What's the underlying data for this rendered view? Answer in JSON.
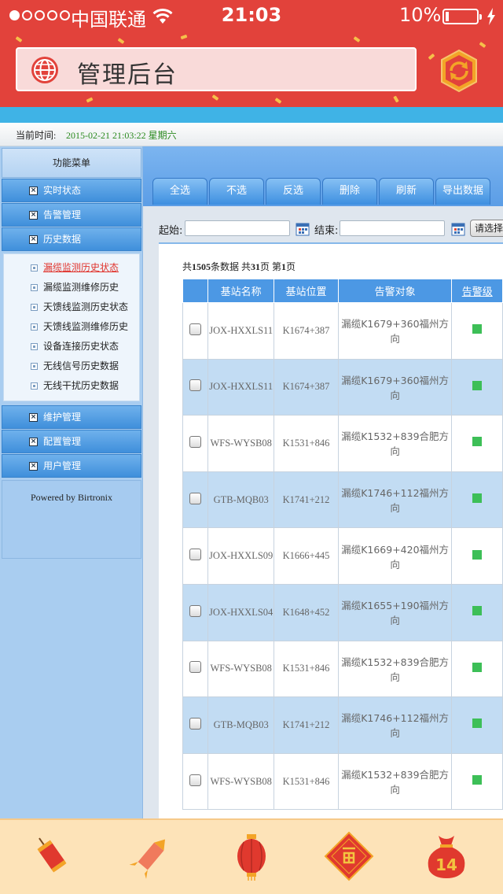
{
  "status_bar": {
    "carrier": "中国联通",
    "time": "21:03",
    "battery": "10%"
  },
  "header": {
    "title": "管理后台"
  },
  "time_bar": {
    "label": "当前时间:",
    "value": "2015-02-21 21:03:22 星期六"
  },
  "sidebar": {
    "menu_title": "功能菜单",
    "items_top": [
      {
        "label": "实时状态"
      },
      {
        "label": "告警管理"
      },
      {
        "label": "历史数据"
      }
    ],
    "submenu": [
      {
        "label": "漏缆监测历史状态",
        "active": true
      },
      {
        "label": "漏缆监测维修历史"
      },
      {
        "label": "天馈线监测历史状态"
      },
      {
        "label": "天馈线监测维修历史"
      },
      {
        "label": "设备连接历史状态"
      },
      {
        "label": "无线信号历史数据"
      },
      {
        "label": "无线干扰历史数据"
      }
    ],
    "items_bottom": [
      {
        "label": "维护管理"
      },
      {
        "label": "配置管理"
      },
      {
        "label": "用户管理"
      }
    ],
    "powered_by": "Powered by Birtronix"
  },
  "toolbar": {
    "select_all": "全选",
    "deselect": "不选",
    "invert": "反选",
    "delete": "删除",
    "refresh": "刷新",
    "export": "导出数据"
  },
  "filters": {
    "start_label": "起始:",
    "end_label": "结束:",
    "select_button": "请选择告"
  },
  "summary": {
    "prefix": "共",
    "total": "1505",
    "mid1": "条数据 共",
    "pages": "31",
    "mid2": "页 第",
    "current": "1",
    "suffix": "页"
  },
  "table": {
    "headers": {
      "station_name": "基站名称",
      "station_location": "基站位置",
      "alarm_target": "告警对象",
      "alarm_level": "告警级"
    },
    "rows": [
      {
        "name": "JOX-HXXLS11",
        "location": "K1674+387",
        "target": "漏缆K1679+360福州方向"
      },
      {
        "name": "JOX-HXXLS11",
        "location": "K1674+387",
        "target": "漏缆K1679+360福州方向"
      },
      {
        "name": "WFS-WYSB08",
        "location": "K1531+846",
        "target": "漏缆K1532+839合肥方向"
      },
      {
        "name": "GTB-MQB03",
        "location": "K1741+212",
        "target": "漏缆K1746+112福州方向"
      },
      {
        "name": "JOX-HXXLS09",
        "location": "K1666+445",
        "target": "漏缆K1669+420福州方向"
      },
      {
        "name": "JOX-HXXLS04",
        "location": "K1648+452",
        "target": "漏缆K1655+190福州方向"
      },
      {
        "name": "WFS-WYSB08",
        "location": "K1531+846",
        "target": "漏缆K1532+839合肥方向"
      },
      {
        "name": "GTB-MQB03",
        "location": "K1741+212",
        "target": "漏缆K1746+112福州方向"
      },
      {
        "name": "WFS-WYSB08",
        "location": "K1531+846",
        "target": "漏缆K1532+839合肥方向"
      }
    ],
    "level_color": "#3dbf57"
  },
  "bottom_bar": {
    "icons": [
      "firecracker-icon",
      "rocket-firework-icon",
      "red-lantern-icon",
      "fu-diamond-icon",
      "lucky-bag-icon"
    ],
    "badge": "14"
  },
  "colors": {
    "header_red": "#e2423b",
    "accent_blue": "#4c98e4",
    "active_link": "#e0332c"
  }
}
